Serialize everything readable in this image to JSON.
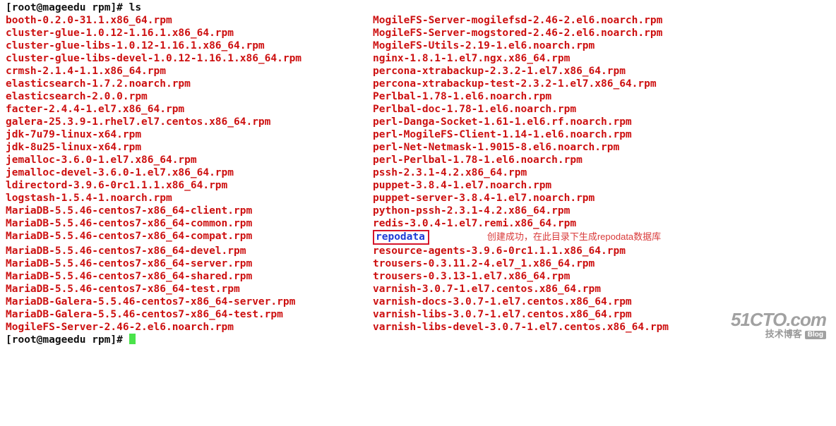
{
  "prompt": {
    "user": "root",
    "host": "mageedu",
    "dir": "rpm",
    "symbol": "#",
    "command": "ls"
  },
  "listing": {
    "left": [
      "booth-0.2.0-31.1.x86_64.rpm",
      "cluster-glue-1.0.12-1.16.1.x86_64.rpm",
      "cluster-glue-libs-1.0.12-1.16.1.x86_64.rpm",
      "cluster-glue-libs-devel-1.0.12-1.16.1.x86_64.rpm",
      "crmsh-2.1.4-1.1.x86_64.rpm",
      "elasticsearch-1.7.2.noarch.rpm",
      "elasticsearch-2.0.0.rpm",
      "facter-2.4.4-1.el7.x86_64.rpm",
      "galera-25.3.9-1.rhel7.el7.centos.x86_64.rpm",
      "jdk-7u79-linux-x64.rpm",
      "jdk-8u25-linux-x64.rpm",
      "jemalloc-3.6.0-1.el7.x86_64.rpm",
      "jemalloc-devel-3.6.0-1.el7.x86_64.rpm",
      "ldirectord-3.9.6-0rc1.1.1.x86_64.rpm",
      "logstash-1.5.4-1.noarch.rpm",
      "MariaDB-5.5.46-centos7-x86_64-client.rpm",
      "MariaDB-5.5.46-centos7-x86_64-common.rpm",
      "MariaDB-5.5.46-centos7-x86_64-compat.rpm",
      "MariaDB-5.5.46-centos7-x86_64-devel.rpm",
      "MariaDB-5.5.46-centos7-x86_64-server.rpm",
      "MariaDB-5.5.46-centos7-x86_64-shared.rpm",
      "MariaDB-5.5.46-centos7-x86_64-test.rpm",
      "MariaDB-Galera-5.5.46-centos7-x86_64-server.rpm",
      "MariaDB-Galera-5.5.46-centos7-x86_64-test.rpm",
      "MogileFS-Server-2.46-2.el6.noarch.rpm"
    ],
    "right": [
      {
        "name": "MogileFS-Server-mogilefsd-2.46-2.el6.noarch.rpm",
        "type": "file"
      },
      {
        "name": "MogileFS-Server-mogstored-2.46-2.el6.noarch.rpm",
        "type": "file"
      },
      {
        "name": "MogileFS-Utils-2.19-1.el6.noarch.rpm",
        "type": "file"
      },
      {
        "name": "nginx-1.8.1-1.el7.ngx.x86_64.rpm",
        "type": "file"
      },
      {
        "name": "percona-xtrabackup-2.3.2-1.el7.x86_64.rpm",
        "type": "file"
      },
      {
        "name": "percona-xtrabackup-test-2.3.2-1.el7.x86_64.rpm",
        "type": "file"
      },
      {
        "name": "Perlbal-1.78-1.el6.noarch.rpm",
        "type": "file"
      },
      {
        "name": "Perlbal-doc-1.78-1.el6.noarch.rpm",
        "type": "file"
      },
      {
        "name": "perl-Danga-Socket-1.61-1.el6.rf.noarch.rpm",
        "type": "file"
      },
      {
        "name": "perl-MogileFS-Client-1.14-1.el6.noarch.rpm",
        "type": "file"
      },
      {
        "name": "perl-Net-Netmask-1.9015-8.el6.noarch.rpm",
        "type": "file"
      },
      {
        "name": "perl-Perlbal-1.78-1.el6.noarch.rpm",
        "type": "file"
      },
      {
        "name": "pssh-2.3.1-4.2.x86_64.rpm",
        "type": "file"
      },
      {
        "name": "puppet-3.8.4-1.el7.noarch.rpm",
        "type": "file"
      },
      {
        "name": "puppet-server-3.8.4-1.el7.noarch.rpm",
        "type": "file"
      },
      {
        "name": "python-pssh-2.3.1-4.2.x86_64.rpm",
        "type": "file"
      },
      {
        "name": "redis-3.0.4-1.el7.remi.x86_64.rpm",
        "type": "file"
      },
      {
        "name": "repodata",
        "type": "dir",
        "annotation": "创建成功，在此目录下生成repodata数据库"
      },
      {
        "name": "resource-agents-3.9.6-0rc1.1.1.x86_64.rpm",
        "type": "file"
      },
      {
        "name": "trousers-0.3.11.2-4.el7_1.x86_64.rpm",
        "type": "file"
      },
      {
        "name": "trousers-0.3.13-1.el7.x86_64.rpm",
        "type": "file"
      },
      {
        "name": "varnish-3.0.7-1.el7.centos.x86_64.rpm",
        "type": "file"
      },
      {
        "name": "varnish-docs-3.0.7-1.el7.centos.x86_64.rpm",
        "type": "file"
      },
      {
        "name": "varnish-libs-3.0.7-1.el7.centos.x86_64.rpm",
        "type": "file"
      },
      {
        "name": "varnish-libs-devel-3.0.7-1.el7.centos.x86_64.rpm",
        "type": "file"
      }
    ]
  },
  "prompt2": {
    "text": "[root@mageedu rpm]#"
  },
  "watermark": {
    "logo": "51CTO.com",
    "sub": "技术博客",
    "blog": "Blog"
  }
}
